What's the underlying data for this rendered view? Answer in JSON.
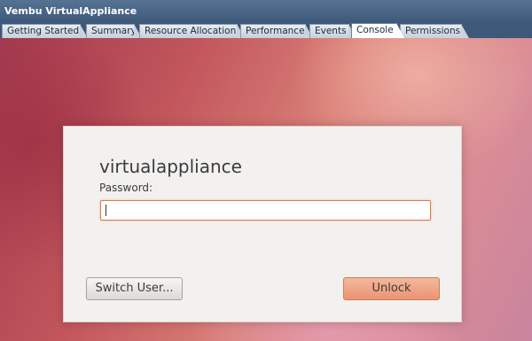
{
  "app": {
    "title": "Vembu VirtualAppliance"
  },
  "tabs": [
    {
      "label": "Getting Started"
    },
    {
      "label": "Summary"
    },
    {
      "label": "Resource Allocation"
    },
    {
      "label": "Performance"
    },
    {
      "label": "Events"
    },
    {
      "label": "Console",
      "active": true
    },
    {
      "label": "Permissions"
    }
  ],
  "login": {
    "username": "virtualappliance",
    "password_label": "Password:",
    "password_value": "",
    "switch_user_label": "Switch User...",
    "unlock_label": "Unlock"
  },
  "colors": {
    "accent": "#e07a4a",
    "titlebar": "#3e5a7b",
    "unlock_button": "#eb9471"
  }
}
